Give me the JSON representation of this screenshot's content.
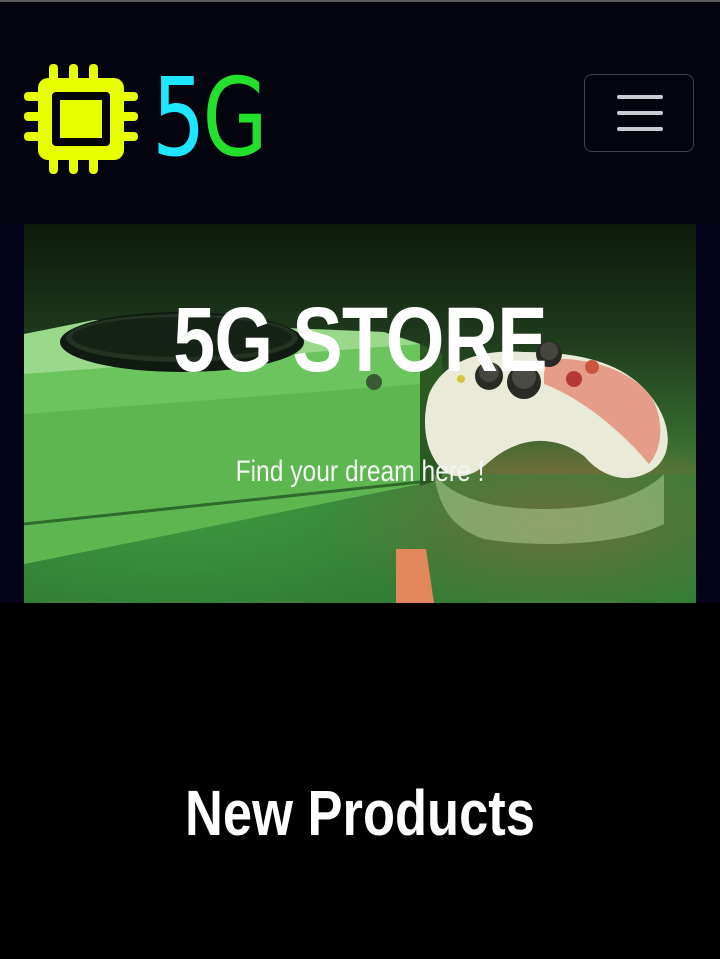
{
  "navbar": {
    "brand_five": "5",
    "brand_g": "G",
    "logo_icon": "cpu-chip-icon",
    "toggler_icon": "hamburger-menu-icon"
  },
  "hero": {
    "title": "5G STORE",
    "subtitle": "Find your dream here !"
  },
  "main": {
    "section_title": "New Products"
  },
  "colors": {
    "navbar_bg": "#04040f",
    "logo_chip": "#e8ff00",
    "brand_five": "#1ee6ff",
    "brand_g": "#23e02c",
    "page_bg": "#000000"
  }
}
